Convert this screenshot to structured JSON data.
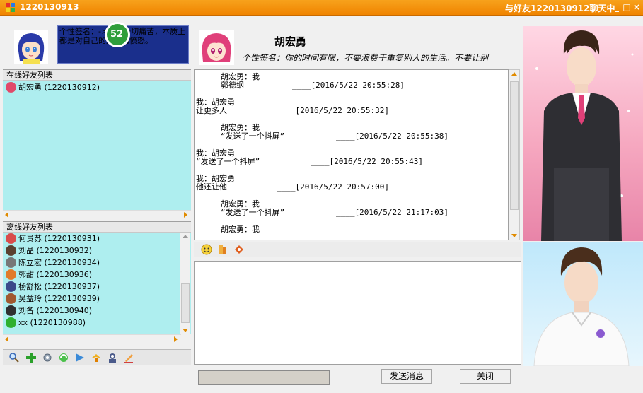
{
  "window": {
    "title_left": "1220130913",
    "title_right": "与好友1220130912聊天中",
    "minimize": "_",
    "maximize": "□",
    "close": "×"
  },
  "self": {
    "signature": "个性签名：->人的一切痛苦，本质上都是对自己的无能的愤怒。"
  },
  "online_group": {
    "title": "在线好友列表",
    "friends": [
      {
        "label": "胡宏勇 (1220130912)",
        "color": "#e04a6a"
      }
    ]
  },
  "offline_group": {
    "title": "离线好友列表",
    "friends": [
      {
        "label": "何贵苏 (1220130931)",
        "color": "#d84c4c"
      },
      {
        "label": "刘晶 (1220130932)",
        "color": "#5a4030"
      },
      {
        "label": "陈立宏 (1220130934)",
        "color": "#777777"
      },
      {
        "label": "郭甜 (1220130936)",
        "color": "#e07a2a"
      },
      {
        "label": "杨舒松 (1220130937)",
        "color": "#3a4a8a"
      },
      {
        "label": "吴益玲 (1220130939)",
        "color": "#a05a30"
      },
      {
        "label": "刘备 (1220130940)",
        "color": "#303030"
      },
      {
        "label": "xx (1220130988)",
        "color": "#2fb02f"
      }
    ]
  },
  "friend": {
    "name": "胡宏勇",
    "signature": "个性签名：你的时间有限，不要浪费于重复别人的生活。不要让别"
  },
  "messages": [
    {
      "indent": true,
      "sender": "胡宏勇：我",
      "text": "郭德纲",
      "time": "____[2016/5/22 20:55:28]"
    },
    {
      "indent": false,
      "sender": "我：胡宏勇",
      "text": "让更多人",
      "time": "____[2016/5/22 20:55:32]"
    },
    {
      "indent": true,
      "sender": "胡宏勇：我",
      "text": "“发送了一个抖屏”",
      "time": "____[2016/5/22 20:55:38]"
    },
    {
      "indent": false,
      "sender": "我：胡宏勇",
      "text": "“发送了一个抖屏”",
      "time": "____[2016/5/22 20:55:43]"
    },
    {
      "indent": false,
      "sender": "我：胡宏勇",
      "text": "他还让他",
      "time": "____[2016/5/22 20:57:00]"
    },
    {
      "indent": true,
      "sender": "胡宏勇：我",
      "text": "“发送了一个抖屏”",
      "time": "____[2016/5/22 21:17:03]"
    },
    {
      "indent": true,
      "sender": "胡宏勇：我",
      "text": "",
      "time": ""
    }
  ],
  "buttons": {
    "send": "发送消息",
    "close": "关闭"
  },
  "badge": "52",
  "icons": {
    "left_toolbar": [
      "search-icon",
      "add-friend-icon",
      "settings-icon",
      "refresh-icon",
      "share-icon",
      "bird-icon",
      "profile-icon",
      "edit-icon"
    ],
    "chat_toolbar": [
      "emoji-icon",
      "font-icon",
      "shake-icon"
    ]
  },
  "colors": {
    "titlebar": "#f08400",
    "list_bg": "#aeeeef",
    "signature_bg": "#1a2f8c"
  }
}
